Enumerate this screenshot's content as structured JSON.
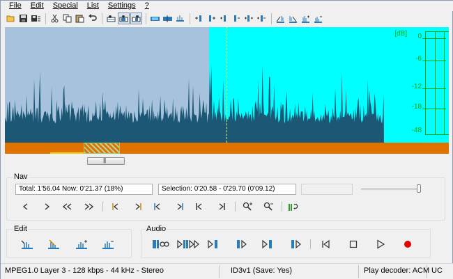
{
  "menu": [
    "File",
    "Edit",
    "Special",
    "List",
    "Settings",
    "?"
  ],
  "toolbar": {
    "icons": [
      "open-icon",
      "save-icon",
      "save-list-icon",
      "cut-icon",
      "copy-icon",
      "paste-icon",
      "undo-icon",
      "view-original-icon",
      "view-selection-icon",
      "view-zoomed-icon",
      "mark-all-icon",
      "mark-split-icon",
      "mark-gap-icon",
      "set-start-icon",
      "set-end-icon",
      "move-start-icon",
      "move-end-icon",
      "extend-left-icon",
      "extend-right-icon",
      "fade-in-icon",
      "fade-out-icon",
      "volume-up-icon",
      "volume-down-icon"
    ]
  },
  "meter": {
    "unit": "[dB]",
    "labels": [
      "0",
      "-6",
      "-12",
      "-18",
      "-48"
    ]
  },
  "overview": {
    "scroll_grip": "|||"
  },
  "nav": {
    "title": "Nav",
    "total_now": "Total: 1'56.04   Now: 0'21.37   (18%)",
    "selection": "Selection: 0'20.58 - 0'29.70 (0'09.12)",
    "volume_level": 1.0
  },
  "edit": {
    "title": "Edit"
  },
  "audio": {
    "title": "Audio"
  },
  "status": {
    "format": "MPEG1.0 Layer 3 - 128 kbps - 44 kHz - Stereo",
    "tag": "ID3v1 (Save: Yes)",
    "decoder": "Play decoder: ACM",
    "encoding": "UC"
  },
  "colors": {
    "wave_background": "#a6c2dc",
    "selection_background": "#00ffff",
    "waveform": "#1c5875",
    "overview": "#e07200",
    "meter": "#00a300",
    "record": "#e00000"
  }
}
